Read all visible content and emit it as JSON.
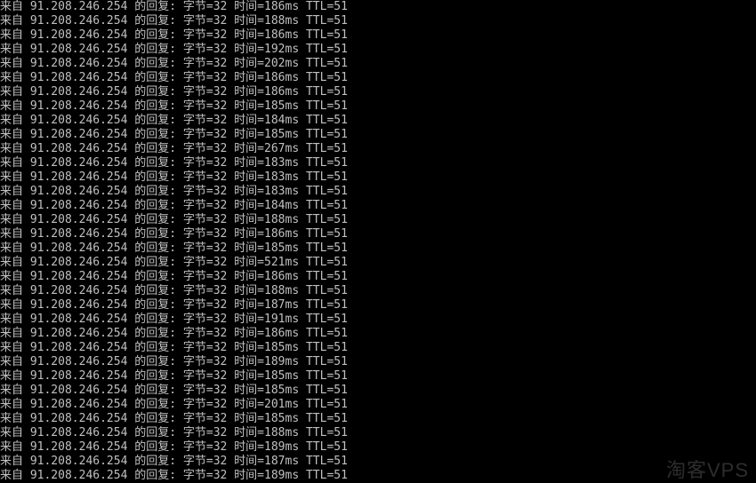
{
  "chart_data": {
    "type": "table",
    "title": "Ping output",
    "columns": [
      "来自 IP",
      "字节",
      "时间(ms)",
      "TTL"
    ],
    "rows": [
      [
        "91.208.246.254",
        32,
        186,
        51
      ],
      [
        "91.208.246.254",
        32,
        188,
        51
      ],
      [
        "91.208.246.254",
        32,
        186,
        51
      ],
      [
        "91.208.246.254",
        32,
        192,
        51
      ],
      [
        "91.208.246.254",
        32,
        202,
        51
      ],
      [
        "91.208.246.254",
        32,
        186,
        51
      ],
      [
        "91.208.246.254",
        32,
        186,
        51
      ],
      [
        "91.208.246.254",
        32,
        185,
        51
      ],
      [
        "91.208.246.254",
        32,
        184,
        51
      ],
      [
        "91.208.246.254",
        32,
        185,
        51
      ],
      [
        "91.208.246.254",
        32,
        267,
        51
      ],
      [
        "91.208.246.254",
        32,
        183,
        51
      ],
      [
        "91.208.246.254",
        32,
        183,
        51
      ],
      [
        "91.208.246.254",
        32,
        183,
        51
      ],
      [
        "91.208.246.254",
        32,
        184,
        51
      ],
      [
        "91.208.246.254",
        32,
        188,
        51
      ],
      [
        "91.208.246.254",
        32,
        186,
        51
      ],
      [
        "91.208.246.254",
        32,
        185,
        51
      ],
      [
        "91.208.246.254",
        32,
        521,
        51
      ],
      [
        "91.208.246.254",
        32,
        186,
        51
      ],
      [
        "91.208.246.254",
        32,
        188,
        51
      ],
      [
        "91.208.246.254",
        32,
        187,
        51
      ],
      [
        "91.208.246.254",
        32,
        191,
        51
      ],
      [
        "91.208.246.254",
        32,
        186,
        51
      ],
      [
        "91.208.246.254",
        32,
        185,
        51
      ],
      [
        "91.208.246.254",
        32,
        189,
        51
      ],
      [
        "91.208.246.254",
        32,
        185,
        51
      ],
      [
        "91.208.246.254",
        32,
        185,
        51
      ],
      [
        "91.208.246.254",
        32,
        201,
        51
      ],
      [
        "91.208.246.254",
        32,
        185,
        51
      ],
      [
        "91.208.246.254",
        32,
        188,
        51
      ],
      [
        "91.208.246.254",
        32,
        189,
        51
      ],
      [
        "91.208.246.254",
        32,
        187,
        51
      ],
      [
        "91.208.246.254",
        32,
        189,
        51
      ]
    ]
  },
  "labels": {
    "from": "来自",
    "reply": "的回复:",
    "bytes": "字节",
    "time": "时间",
    "ttl": "TTL"
  },
  "watermark": "淘客VPS"
}
